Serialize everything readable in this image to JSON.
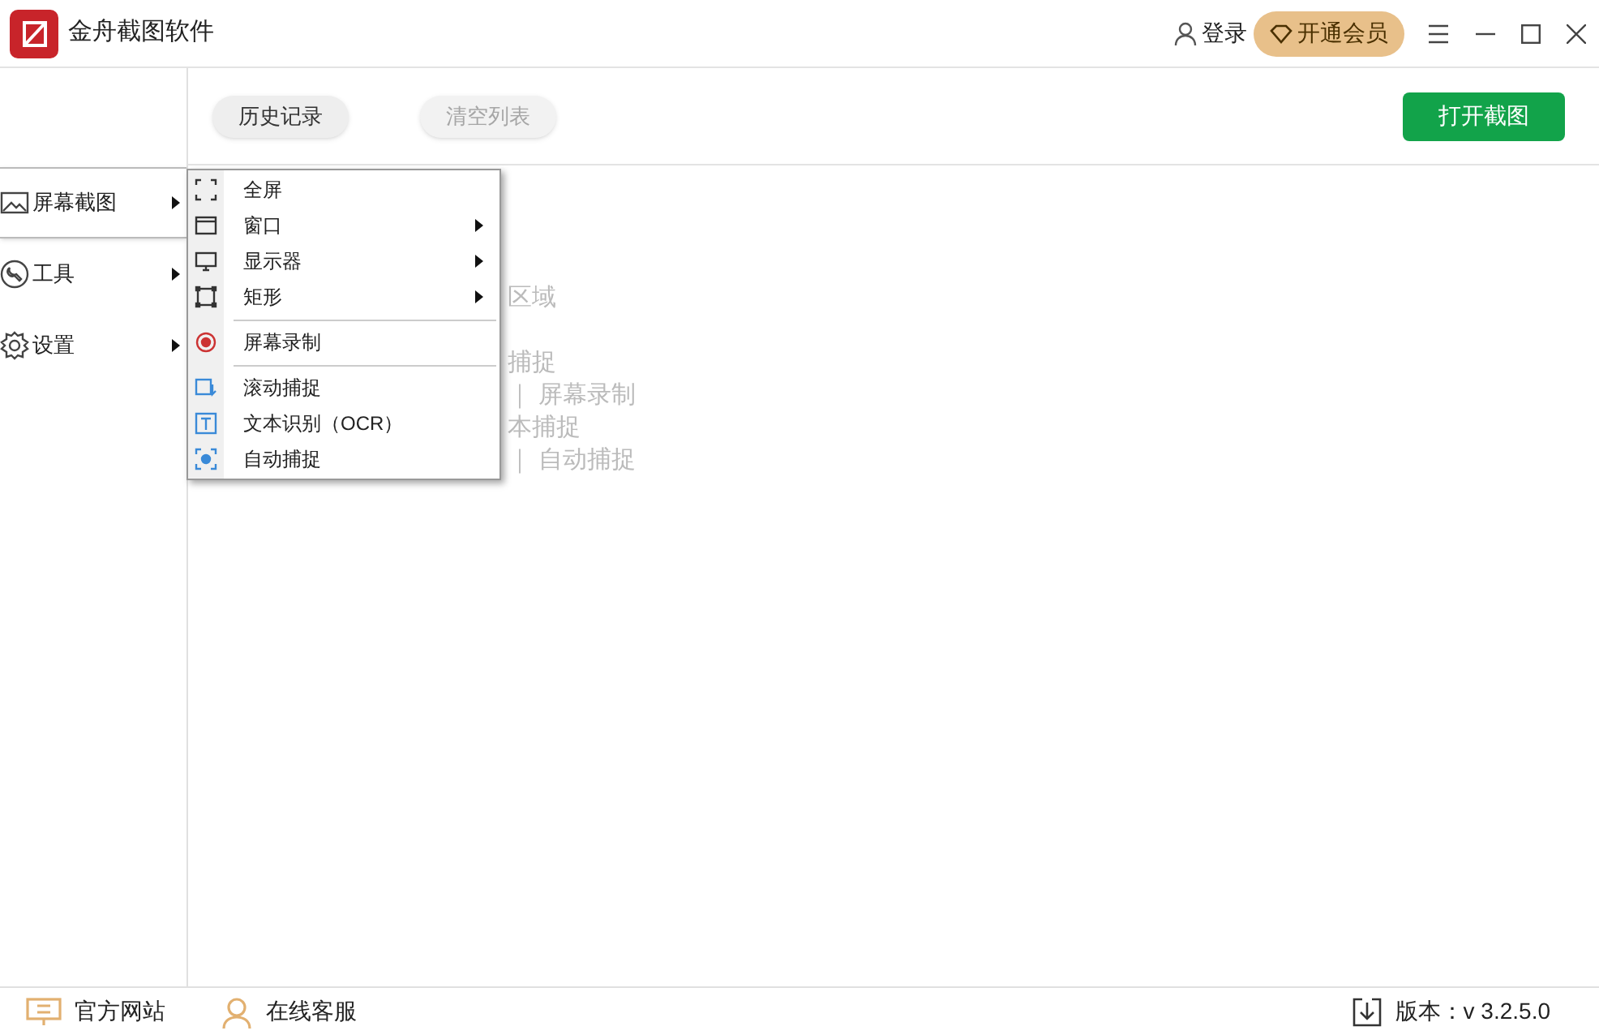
{
  "window": {
    "title": "金舟截图软件"
  },
  "header": {
    "login": "登录",
    "vip": "开通会员"
  },
  "toolbar": {
    "buttons": [
      {
        "label": "历史记录",
        "disabled": false
      },
      {
        "label": "清空列表",
        "disabled": true
      }
    ],
    "primary": "打开截图"
  },
  "sidebar": {
    "items": [
      {
        "label": "屏幕截图",
        "selected": true
      },
      {
        "label": "工具",
        "selected": false
      },
      {
        "label": "设置",
        "selected": false
      }
    ]
  },
  "background_text": [
    "区域",
    "捕捉",
    "｜ 屏幕录制",
    "本捕捉",
    "｜ 自动捕捉"
  ],
  "menu": {
    "items": [
      {
        "kind": "item",
        "label": "全屏",
        "submenu": false
      },
      {
        "kind": "item",
        "label": "窗口",
        "submenu": true
      },
      {
        "kind": "item",
        "label": "显示器",
        "submenu": true
      },
      {
        "kind": "item",
        "label": "矩形",
        "submenu": true
      },
      {
        "kind": "separator"
      },
      {
        "kind": "item",
        "label": "屏幕录制",
        "submenu": false
      },
      {
        "kind": "separator"
      },
      {
        "kind": "item",
        "label": "滚动捕捉",
        "submenu": false
      },
      {
        "kind": "item",
        "label": "文本识别（OCR）",
        "submenu": false
      },
      {
        "kind": "item",
        "label": "自动捕捉",
        "submenu": false
      }
    ]
  },
  "footer": {
    "links": [
      {
        "label": "官方网站"
      },
      {
        "label": "在线客服"
      }
    ],
    "version": "版本：v 3.2.5.0"
  }
}
